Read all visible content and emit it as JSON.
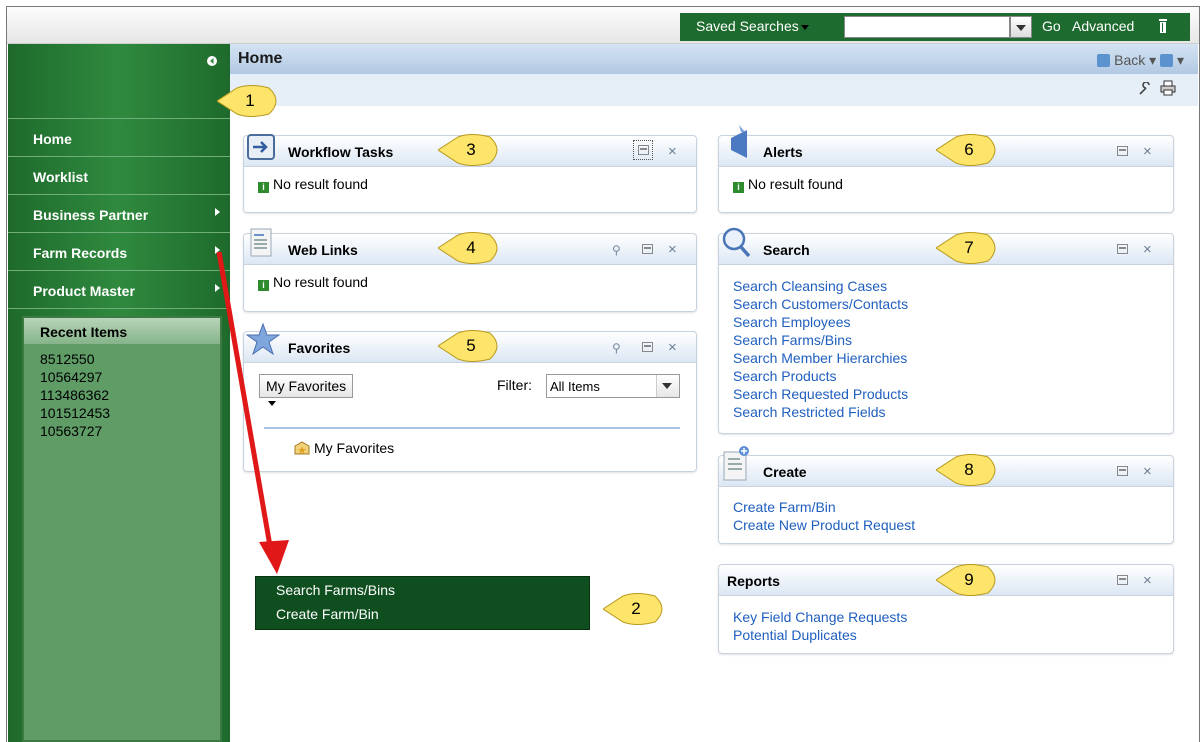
{
  "topbar": {
    "saved_searches": "Saved Searches",
    "search_value": "",
    "go": "Go",
    "advanced": "Advanced"
  },
  "nav": {
    "items": [
      {
        "label": "Home",
        "has_submenu": false
      },
      {
        "label": "Worklist",
        "has_submenu": false
      },
      {
        "label": "Business Partner",
        "has_submenu": true
      },
      {
        "label": "Farm Records",
        "has_submenu": true
      },
      {
        "label": "Product Master",
        "has_submenu": true
      }
    ],
    "recent": {
      "title": "Recent Items",
      "items": [
        "8512550",
        "10564297",
        "113486362",
        "101512453",
        "10563727"
      ]
    }
  },
  "header": {
    "title": "Home",
    "back": "Back"
  },
  "portlets": {
    "workflow": {
      "title": "Workflow Tasks",
      "body": "No result found"
    },
    "weblinks": {
      "title": "Web Links",
      "body": "No result found"
    },
    "favorites": {
      "title": "Favorites",
      "dropdown": "My Favorites",
      "filter_label": "Filter:",
      "filter_value": "All Items",
      "item": "My Favorites"
    },
    "alerts": {
      "title": "Alerts",
      "body": "No result found"
    },
    "search": {
      "title": "Search",
      "links": [
        "Search Cleansing Cases",
        "Search Customers/Contacts",
        "Search Employees",
        "Search Farms/Bins",
        "Search Member Hierarchies",
        "Search Products",
        "Search Requested Products",
        "Search Restricted Fields"
      ]
    },
    "create": {
      "title": "Create",
      "links": [
        "Create Farm/Bin",
        "Create New Product Request"
      ]
    },
    "reports": {
      "title": "Reports",
      "links": [
        "Key Field Change Requests",
        "Potential Duplicates"
      ]
    }
  },
  "popup_menu": {
    "items": [
      "Search Farms/Bins",
      "Create Farm/Bin"
    ]
  },
  "callouts": [
    "1",
    "2",
    "3",
    "4",
    "5",
    "6",
    "7",
    "8",
    "9"
  ],
  "colors": {
    "nav_green": "#2f8a3e",
    "popup_green": "#0f4f1f",
    "callout_yellow": "#fde46a",
    "link_blue": "#1f5fbf",
    "arrow_red": "#e01818"
  }
}
